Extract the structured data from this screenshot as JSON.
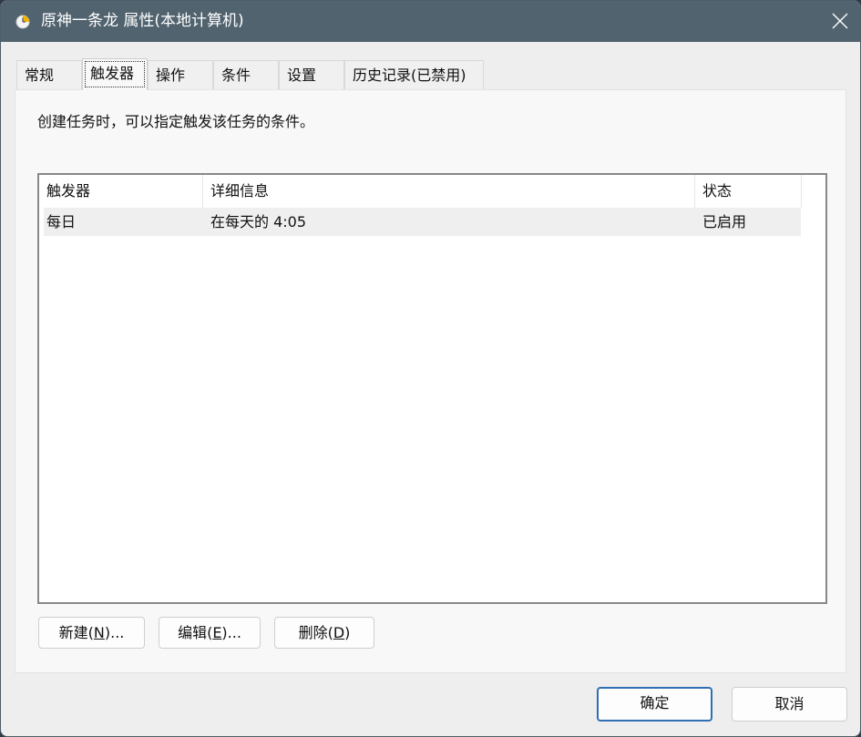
{
  "window": {
    "title": "原神一条龙 属性(本地计算机)"
  },
  "tabs": [
    {
      "label": "常规",
      "active": false
    },
    {
      "label": "触发器",
      "active": true
    },
    {
      "label": "操作",
      "active": false
    },
    {
      "label": "条件",
      "active": false
    },
    {
      "label": "设置",
      "active": false
    },
    {
      "label": "历史记录(已禁用)",
      "active": false
    }
  ],
  "triggers_tab": {
    "description": "创建任务时，可以指定触发该任务的条件。",
    "columns": [
      "触发器",
      "详细信息",
      "状态"
    ],
    "rows": [
      {
        "trigger": "每日",
        "details": "在每天的 4:05",
        "status": "已启用"
      }
    ],
    "buttons": {
      "new": {
        "prefix": "新建(",
        "accel": "N",
        "suffix": ")..."
      },
      "edit": {
        "prefix": "编辑(",
        "accel": "E",
        "suffix": ")..."
      },
      "delete": {
        "prefix": "删除(",
        "accel": "D",
        "suffix": ")"
      }
    }
  },
  "footer": {
    "ok_label": "确定",
    "cancel_label": "取消"
  },
  "colors": {
    "titlebar": "#51636f",
    "primary_border": "#2f6fb3"
  },
  "icons": {
    "title": "clock-icon",
    "close": "close-icon"
  }
}
